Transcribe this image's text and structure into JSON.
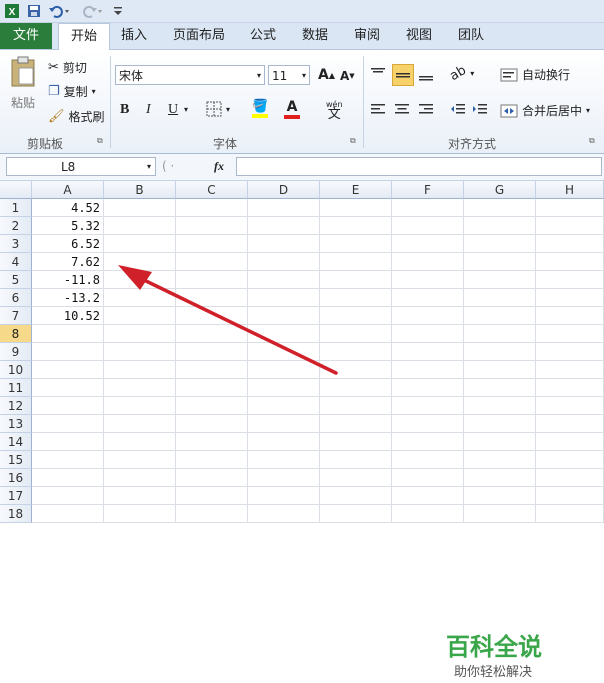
{
  "qat": {
    "excel_icon": "excel-icon",
    "save_icon": "save-icon",
    "undo_icon": "undo-icon",
    "redo_icon": "redo-icon"
  },
  "tabs": [
    {
      "label": "文件"
    },
    {
      "label": "开始"
    },
    {
      "label": "插入"
    },
    {
      "label": "页面布局"
    },
    {
      "label": "公式"
    },
    {
      "label": "数据"
    },
    {
      "label": "审阅"
    },
    {
      "label": "视图"
    },
    {
      "label": "团队"
    }
  ],
  "clipboard": {
    "paste": "粘贴",
    "cut": "剪切",
    "copy": "复制",
    "format_painter": "格式刷",
    "group": "剪贴板"
  },
  "font": {
    "name": "宋体",
    "size": "11",
    "bold": "B",
    "italic": "I",
    "underline": "U",
    "group": "字体",
    "font_color": "A",
    "phonetic": "wén"
  },
  "align": {
    "wrap": "自动换行",
    "merge": "合并后居中",
    "group": "对齐方式"
  },
  "formula_bar": {
    "name_box": "L8",
    "fx": "fx"
  },
  "columns": [
    "A",
    "B",
    "C",
    "D",
    "E",
    "F",
    "G",
    "H"
  ],
  "rows": [
    "1",
    "2",
    "3",
    "4",
    "5",
    "6",
    "7",
    "8",
    "9",
    "10",
    "11",
    "12",
    "13",
    "14",
    "15",
    "16",
    "17",
    "18"
  ],
  "cells_a": [
    "4.52",
    "5.32",
    "6.52",
    "7.62",
    "-11.8",
    "-13.2",
    "10.52"
  ],
  "watermark": {
    "title": "百科全说",
    "subtitle": "助你轻松解决"
  },
  "colors": {
    "file_tab": "#2a7d3b",
    "arrow": "#d0202a",
    "selected_row": "#f7d98a"
  }
}
